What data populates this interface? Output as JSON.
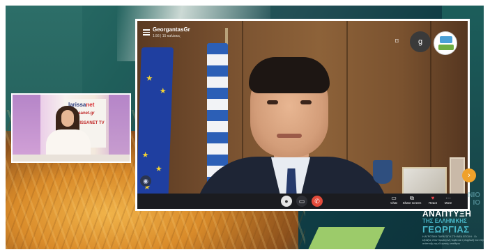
{
  "call": {
    "title": "GeorgantasGr",
    "subtitle": "1:56 | 15 καλέσεις",
    "avatar_initial": "g",
    "controls": {
      "mic_icon": "mic-icon",
      "camera_icon": "camera-icon",
      "end_icon": "end-call-icon"
    },
    "toolbar": [
      {
        "label": "Chat",
        "glyph": "▭"
      },
      {
        "label": "Share screen",
        "glyph": "⧉"
      },
      {
        "label": "React",
        "glyph": "♥"
      },
      {
        "label": "More",
        "glyph": "···"
      }
    ]
  },
  "studio": {
    "logo_main": "larissa",
    "logo_main_accent": "net",
    "logo_sub": "larissanet.gr",
    "logo_tv": "LARISSANET TV"
  },
  "branding": {
    "faint_line1": "ΝΙΟ",
    "faint_line2": "ΙΟ",
    "line1": "ΑΝΑΠΤΥΞΗ",
    "line2": "ΤΗΣ ΕΛΛΗΝΙΚΗΣ",
    "line3": "ΓΕΩΡΓΙΑΣ",
    "small_text": "Η ΑΓΡΟΤΙΚΗ ΠΑΡΑΓΩΓΗ ΣΤΗ ΝΕΑ ΕΠΟΧΗ · Οι εξελίξεις στον πρωτογενή τομέα και η συμβολή του στην ανάπτυξη της ελληνικής υπαίθρου"
  },
  "colors": {
    "accent_orange": "#f0a12a",
    "brand_teal": "#49b8c9",
    "end_call_red": "#e34b3b"
  }
}
